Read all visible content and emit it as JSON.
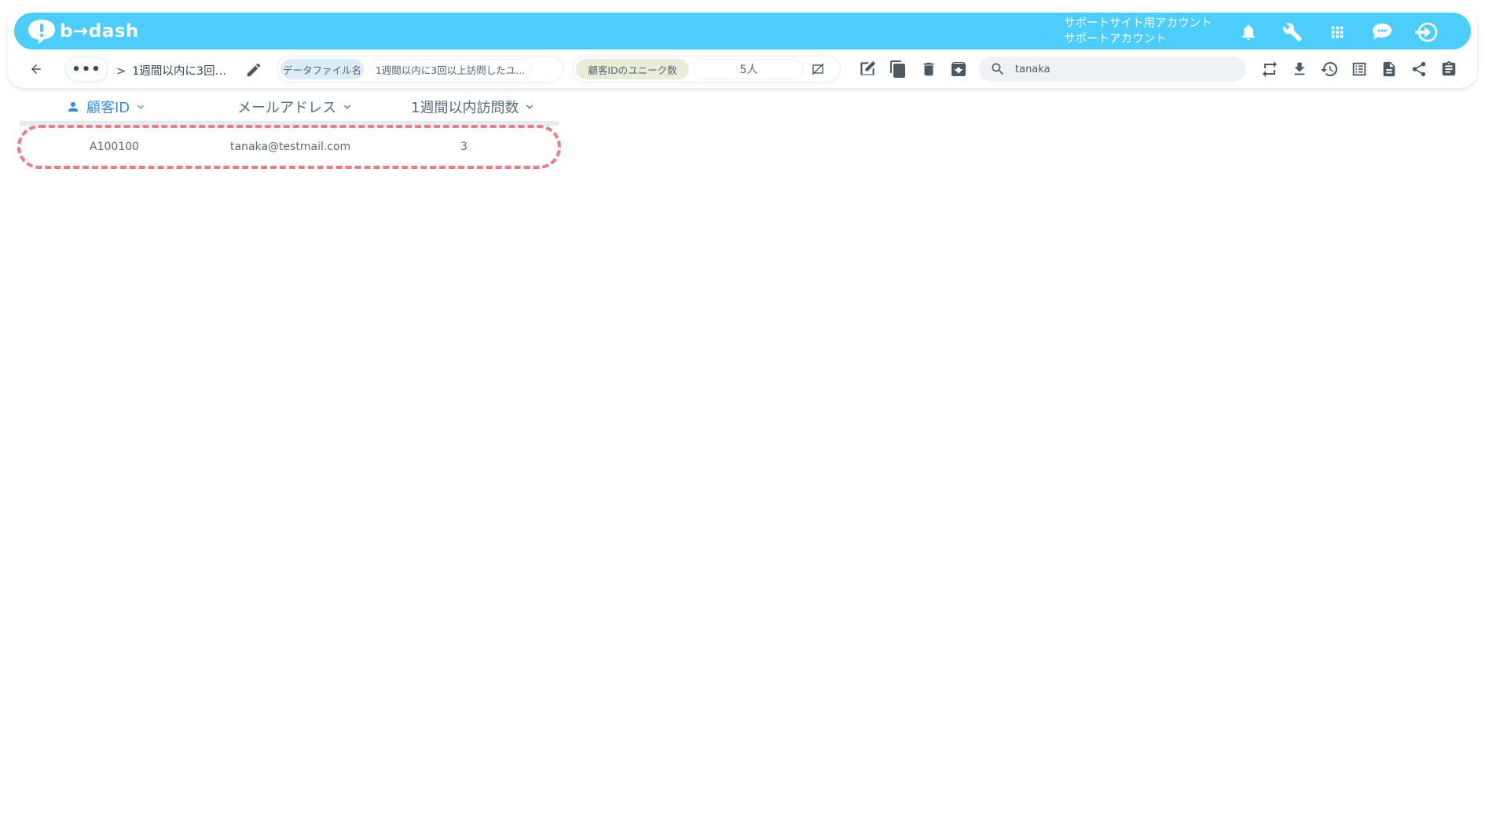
{
  "brand": {
    "logo_text": "b→dash",
    "color": "#4dcdfb"
  },
  "account": {
    "line1": "サポートサイト用アカウント",
    "line2": "サポートアカウント"
  },
  "header_icons": [
    "bell-icon",
    "wrench-icon",
    "apps-grid-icon",
    "chat-cloud-icon",
    "logout-icon"
  ],
  "breadcrumb": {
    "more": "•••",
    "separator": ">",
    "current": "1週間以内に3回…"
  },
  "datafile": {
    "label": "データファイル名",
    "value": "1週間以内に3回以上訪問したユ...",
    "label_bg": "#dcecf7"
  },
  "unique_count": {
    "label": "顧客IDのユニーク数",
    "value": "5人",
    "label_bg": "#e8ecd9"
  },
  "toolbar_icons": [
    "edit-icon",
    "copy-icon",
    "delete-icon",
    "archive-icon",
    "repeat-icon",
    "download-icon",
    "history-icon",
    "list-icon",
    "document-icon",
    "share-icon",
    "clipboard-icon"
  ],
  "search": {
    "value": "tanaka",
    "placeholder": ""
  },
  "table": {
    "columns": [
      {
        "label": "顧客ID",
        "active": true
      },
      {
        "label": "メールアドレス",
        "active": false
      },
      {
        "label": "1週間以内訪問数",
        "active": false
      }
    ],
    "rows": [
      {
        "id": "A100100",
        "email": "tanaka@testmail.com",
        "visits": "3"
      }
    ]
  },
  "highlight_color": "#f07a84"
}
